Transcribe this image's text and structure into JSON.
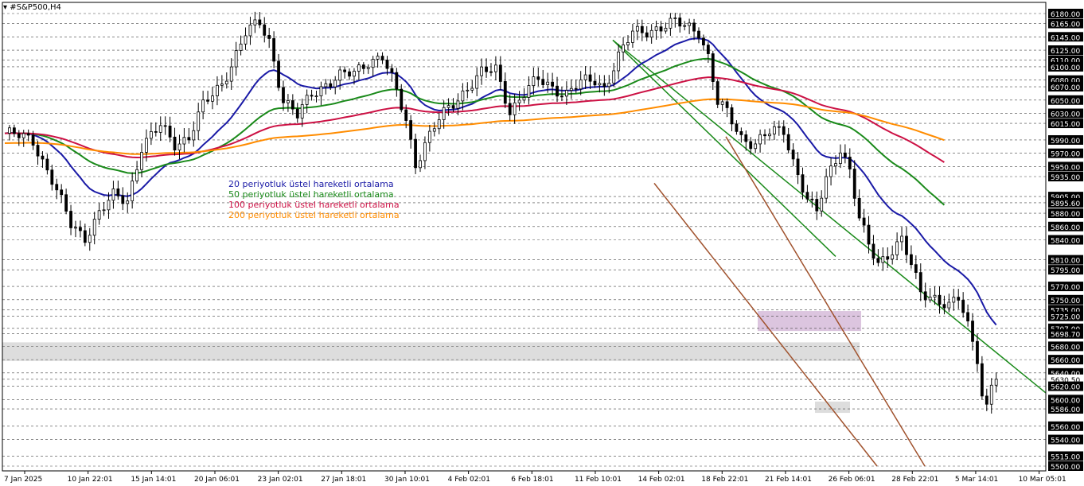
{
  "chart_title": "#S&P500,H4",
  "chart_data": {
    "type": "candlestick",
    "symbol": "#S&P500",
    "timeframe": "H4",
    "title": "#S&P500,H4",
    "ylim": [
      5500,
      6180
    ],
    "x_ticks": [
      "7 Jan 2025",
      "10 Jan 22:01",
      "15 Jan 14:01",
      "20 Jan 06:01",
      "23 Jan 02:01",
      "27 Jan 18:01",
      "30 Jan 10:01",
      "4 Feb 02:01",
      "6 Feb 18:01",
      "11 Feb 10:01",
      "14 Feb 02:01",
      "18 Feb 22:01",
      "21 Feb 14:01",
      "26 Feb 06:01",
      "28 Feb 22:01",
      "5 Mar 14:01",
      "10 Mar 05:01"
    ],
    "y_ticks": [
      "6180.00",
      "6165.00",
      "6145.00",
      "6125.00",
      "6110.00",
      "6100.00",
      "6080.00",
      "6070.00",
      "6050.00",
      "6030.00",
      "6015.00",
      "5990.00",
      "5970.00",
      "5950.00",
      "5935.00",
      "5905.00",
      "5895.60",
      "5880.00",
      "5860.00",
      "5840.00",
      "5810.00",
      "5795.00",
      "5770.00",
      "5750.00",
      "5735.00",
      "5725.00",
      "5707.00",
      "5698.70",
      "5680.00",
      "5660.00",
      "5640.00",
      "5630.50",
      "5620.00",
      "5600.00",
      "5586.00",
      "5560.00",
      "5540.00",
      "5515.00",
      "5500.00"
    ],
    "last_price": "5630.50",
    "legend": [
      {
        "label": "20 periyotluk üstel hareketli ortalama",
        "color": "#1a1aa6"
      },
      {
        "label": "50 periyotluk üstel hareketli ortalama",
        "color": "#1a8a1a"
      },
      {
        "label": "100 periyotluk üstel hareketli ortalama",
        "color": "#cc1144"
      },
      {
        "label": "200 periyotluk üstel hareketli ortalama",
        "color": "#ff8c00"
      }
    ],
    "price_path": [
      [
        0,
        6000
      ],
      [
        6,
        5990
      ],
      [
        10,
        5930
      ],
      [
        14,
        5862
      ],
      [
        17,
        5845
      ],
      [
        20,
        5880
      ],
      [
        23,
        5905
      ],
      [
        26,
        5900
      ],
      [
        29,
        5980
      ],
      [
        33,
        6010
      ],
      [
        36,
        5985
      ],
      [
        39,
        5995
      ],
      [
        42,
        6040
      ],
      [
        46,
        6075
      ],
      [
        49,
        6120
      ],
      [
        51,
        6150
      ],
      [
        54,
        6165
      ],
      [
        56,
        6140
      ],
      [
        59,
        6050
      ],
      [
        62,
        6025
      ],
      [
        65,
        6060
      ],
      [
        68,
        6075
      ],
      [
        71,
        6085
      ],
      [
        74,
        6090
      ],
      [
        77,
        6110
      ],
      [
        80,
        6115
      ],
      [
        82,
        6080
      ],
      [
        85,
        6020
      ],
      [
        87,
        5955
      ],
      [
        89,
        5985
      ],
      [
        92,
        6020
      ],
      [
        95,
        6045
      ],
      [
        98,
        6070
      ],
      [
        101,
        6090
      ],
      [
        104,
        6095
      ],
      [
        107,
        6035
      ],
      [
        110,
        6060
      ],
      [
        113,
        6080
      ],
      [
        116,
        6070
      ],
      [
        119,
        6060
      ],
      [
        122,
        6075
      ],
      [
        125,
        6080
      ],
      [
        127,
        6070
      ],
      [
        130,
        6115
      ],
      [
        133,
        6150
      ],
      [
        136,
        6155
      ],
      [
        139,
        6160
      ],
      [
        142,
        6165
      ],
      [
        145,
        6160
      ],
      [
        147,
        6155
      ],
      [
        149,
        6115
      ],
      [
        151,
        6045
      ],
      [
        153,
        6030
      ],
      [
        156,
        5995
      ],
      [
        159,
        5985
      ],
      [
        162,
        6000
      ],
      [
        165,
        6005
      ],
      [
        167,
        5960
      ],
      [
        170,
        5900
      ],
      [
        172,
        5880
      ],
      [
        174,
        5930
      ],
      [
        177,
        5980
      ],
      [
        179,
        5945
      ],
      [
        181,
        5870
      ],
      [
        183,
        5830
      ],
      [
        185,
        5805
      ],
      [
        187,
        5820
      ],
      [
        190,
        5840
      ],
      [
        192,
        5800
      ],
      [
        194,
        5760
      ],
      [
        197,
        5755
      ],
      [
        200,
        5740
      ],
      [
        202,
        5750
      ],
      [
        204,
        5710
      ],
      [
        206,
        5665
      ],
      [
        207,
        5610
      ],
      [
        208,
        5590
      ],
      [
        209,
        5625
      ],
      [
        210,
        5630.5
      ]
    ]
  },
  "colors": {
    "bull": "#000000",
    "bear": "#000000",
    "ema20": "#1a1aa6",
    "ema50": "#1a8a1a",
    "ema100": "#cc1144",
    "ema200": "#ff8c00",
    "channel": "#a0522d",
    "trend_green": "#1a8a1a",
    "grid": "#444444",
    "zone_grey": "#d9d9d9",
    "zone_purple": "#d8bfdc",
    "axis_label_bg": "#000000",
    "axis_label_fg": "#ffffff"
  }
}
